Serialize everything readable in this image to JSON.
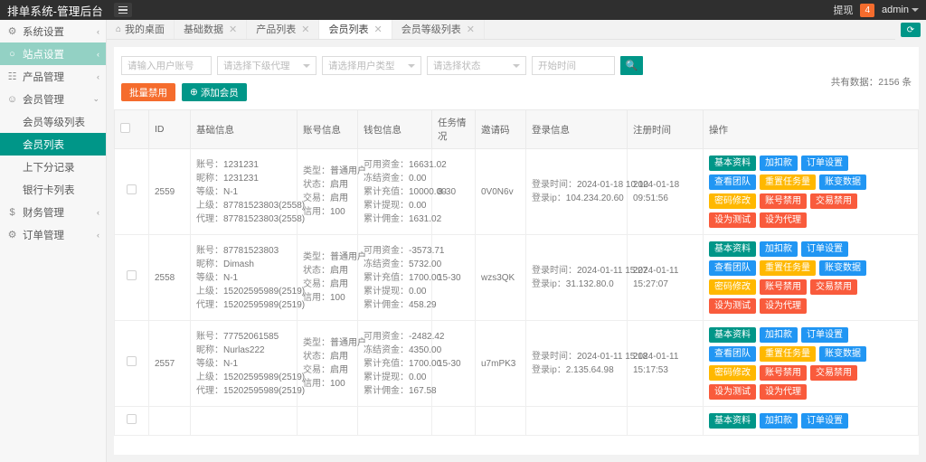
{
  "header": {
    "brand": "排单系统-管理后台",
    "menu_icon": "hamburger-icon",
    "withdraw_label": "提现",
    "withdraw_badge": "4",
    "admin_label": "admin"
  },
  "sidebar": {
    "items": [
      {
        "label": "系统设置",
        "icon": "gear-icon",
        "arrow": "‹",
        "state": "normal"
      },
      {
        "label": "站点设置",
        "icon": "globe-icon",
        "arrow": "‹",
        "state": "highlight"
      },
      {
        "label": "产品管理",
        "icon": "box-icon",
        "arrow": "‹",
        "state": "normal"
      },
      {
        "label": "会员管理",
        "icon": "user-icon",
        "arrow": "⌄",
        "state": "normal"
      },
      {
        "label": "会员等级列表",
        "icon": "",
        "arrow": "",
        "state": "sub"
      },
      {
        "label": "会员列表",
        "icon": "",
        "arrow": "",
        "state": "active"
      },
      {
        "label": "上下分记录",
        "icon": "",
        "arrow": "",
        "state": "sub"
      },
      {
        "label": "银行卡列表",
        "icon": "",
        "arrow": "",
        "state": "sub"
      },
      {
        "label": "财务管理",
        "icon": "money-icon",
        "arrow": "‹",
        "state": "normal"
      },
      {
        "label": "订单管理",
        "icon": "order-icon",
        "arrow": "‹",
        "state": "normal"
      }
    ]
  },
  "tabs": [
    {
      "label": "我的桌面",
      "closable": false,
      "active": false,
      "icon": "home-icon"
    },
    {
      "label": "基础数据",
      "closable": true,
      "active": false,
      "icon": ""
    },
    {
      "label": "产品列表",
      "closable": true,
      "active": false,
      "icon": ""
    },
    {
      "label": "会员列表",
      "closable": true,
      "active": true,
      "icon": ""
    },
    {
      "label": "会员等级列表",
      "closable": true,
      "active": false,
      "icon": ""
    }
  ],
  "toolbar": {
    "refresh_icon": "refresh-icon"
  },
  "filters": {
    "account_placeholder": "请输入用户账号",
    "agent_placeholder": "请选择下级代理",
    "usertype_placeholder": "请选择用户类型",
    "status_placeholder": "请选择状态",
    "starttime_placeholder": "开始时间",
    "search_icon": "search-icon",
    "batch_disable_label": "批量禁用",
    "add_member_label": "添加会员",
    "add_member_icon": "plus-circle-icon"
  },
  "summary": {
    "total_text": "共有数据：2156 条"
  },
  "table": {
    "columns": [
      "",
      "ID",
      "基础信息",
      "账号信息",
      "钱包信息",
      "任务情况",
      "邀请码",
      "登录信息",
      "注册时间",
      "操作"
    ],
    "labels": {
      "account": "账号：",
      "nickname": "昵称：",
      "level": "等级：",
      "parent": "上级：",
      "agent": "代理：",
      "type": "类型：",
      "status": "状态：",
      "trade": "交易：",
      "credit": "信用：",
      "available": "可用资金：",
      "frozen": "冻结资金：",
      "recharge": "累计充值：",
      "withdraw": "累计提现：",
      "commission": "累计佣金：",
      "login_time": "登录时间：",
      "login_ip": "登录ip："
    },
    "rows": [
      {
        "id": "2559",
        "basic": {
          "account": "1231231",
          "nickname": "1231231",
          "level": "N-1",
          "parent": "87781523803(2558)",
          "agent": "87781523803(2558)"
        },
        "account_info": {
          "type": "普通用户",
          "status": "启用",
          "trade": "启用",
          "credit": "100"
        },
        "wallet": {
          "available": "16631.02",
          "frozen": "0.00",
          "recharge": "10000.00",
          "withdraw": "0.00",
          "commission": "1631.02"
        },
        "task": "8-30",
        "invite_code": "0V0N6v",
        "login": {
          "time": "2024-01-18 10:10",
          "ip": "104.234.20.60"
        },
        "register_time": "2024-01-18 09:51:56"
      },
      {
        "id": "2558",
        "basic": {
          "account": "87781523803",
          "nickname": "Dimash",
          "level": "N-1",
          "parent": "15202595989(2519)",
          "agent": "15202595989(2519)"
        },
        "account_info": {
          "type": "普通用户",
          "status": "启用",
          "trade": "启用",
          "credit": "100"
        },
        "wallet": {
          "available": "-3573.71",
          "frozen": "5732.00",
          "recharge": "1700.00",
          "withdraw": "0.00",
          "commission": "458.29"
        },
        "task": "15-30",
        "invite_code": "wzs3QK",
        "login": {
          "time": "2024-01-11 15:27",
          "ip": "31.132.80.0"
        },
        "register_time": "2024-01-11 15:27:07"
      },
      {
        "id": "2557",
        "basic": {
          "account": "77752061585",
          "nickname": "Nurlas222",
          "level": "N-1",
          "parent": "15202595989(2519)",
          "agent": "15202595989(2519)"
        },
        "account_info": {
          "type": "普通用户",
          "status": "启用",
          "trade": "启用",
          "credit": "100"
        },
        "wallet": {
          "available": "-2482.42",
          "frozen": "4350.00",
          "recharge": "1700.00",
          "withdraw": "0.00",
          "commission": "167.58"
        },
        "task": "15-30",
        "invite_code": "u7mPK3",
        "login": {
          "time": "2024-01-11 15:18",
          "ip": "2.135.64.98"
        },
        "register_time": "2024-01-11 15:17:53"
      }
    ],
    "operations": [
      [
        {
          "label": "基本资料",
          "color": "green"
        },
        {
          "label": "加扣款",
          "color": "blue"
        },
        {
          "label": "订单设置",
          "color": "blue"
        }
      ],
      [
        {
          "label": "查看团队",
          "color": "blue"
        },
        {
          "label": "重置任务量",
          "color": "yellow"
        },
        {
          "label": "账变数据",
          "color": "blue"
        }
      ],
      [
        {
          "label": "密码修改",
          "color": "yellow"
        },
        {
          "label": "账号禁用",
          "color": "red"
        },
        {
          "label": "交易禁用",
          "color": "red"
        }
      ],
      [
        {
          "label": "设为测试",
          "color": "red"
        },
        {
          "label": "设为代理",
          "color": "red"
        }
      ]
    ]
  },
  "colors": {
    "brand_teal": "#009688",
    "orange": "#f56c2d",
    "blue": "#2196f3",
    "yellow": "#ffb800",
    "red": "#f95b3c",
    "sidebar_highlight": "#93d1c4"
  }
}
